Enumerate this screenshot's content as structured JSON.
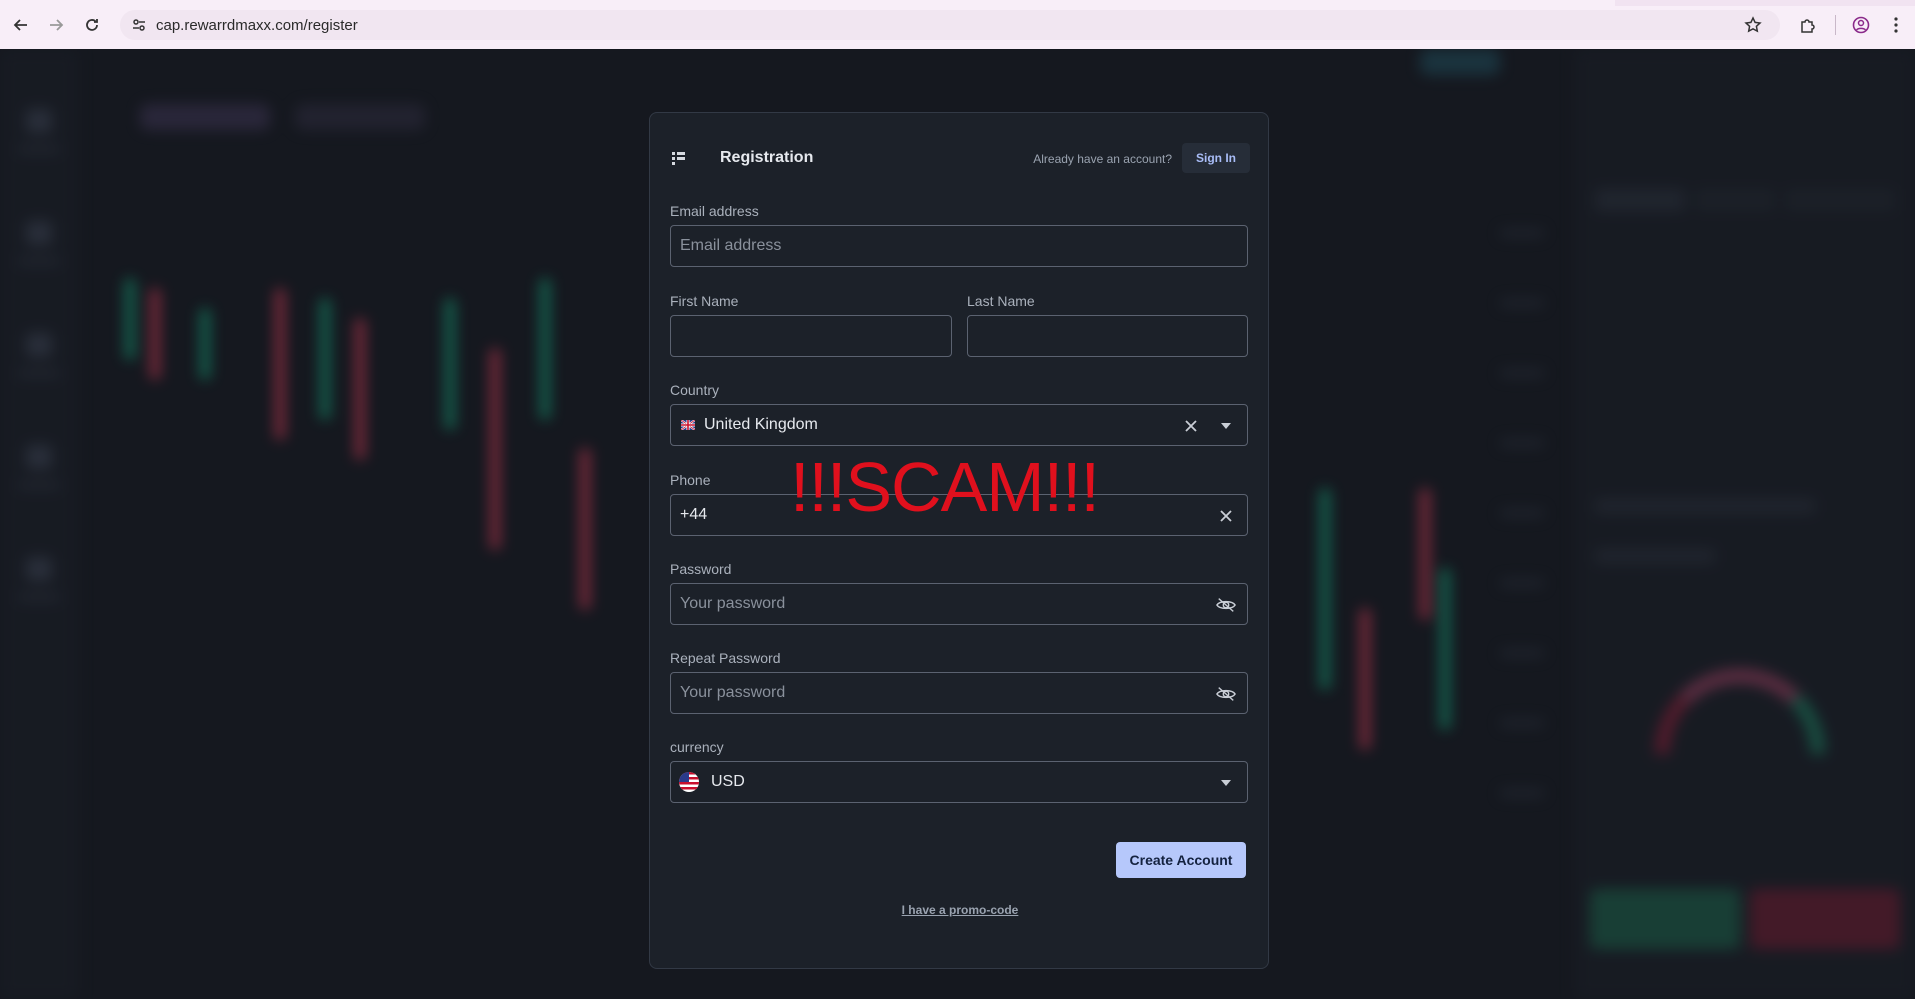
{
  "browser": {
    "url": "cap.rewarrdmaxx.com/register"
  },
  "modal": {
    "title": "Registration",
    "have_account_text": "Already have an account?",
    "sign_in_label": "Sign In",
    "email": {
      "label": "Email address",
      "placeholder": "Email address",
      "value": ""
    },
    "first_name": {
      "label": "First Name",
      "value": ""
    },
    "last_name": {
      "label": "Last Name",
      "value": ""
    },
    "country": {
      "label": "Country",
      "value": "United Kingdom",
      "flag": "uk-flag-icon"
    },
    "phone": {
      "label": "Phone",
      "value": "+44"
    },
    "password": {
      "label": "Password",
      "placeholder": "Your password"
    },
    "repeat_password": {
      "label": "Repeat Password",
      "placeholder": "Your password"
    },
    "currency": {
      "label": "currency",
      "value": "USD",
      "flag": "us-flag-icon"
    },
    "create_button_label": "Create Account",
    "promo_link": "I have a promo-code"
  },
  "overlay": {
    "text": "!!!SCAM!!!",
    "color": "#e0101d"
  },
  "colors": {
    "accent": "#b6c8fb",
    "modal_bg": "#1c2129",
    "page_bg": "#15181f"
  }
}
